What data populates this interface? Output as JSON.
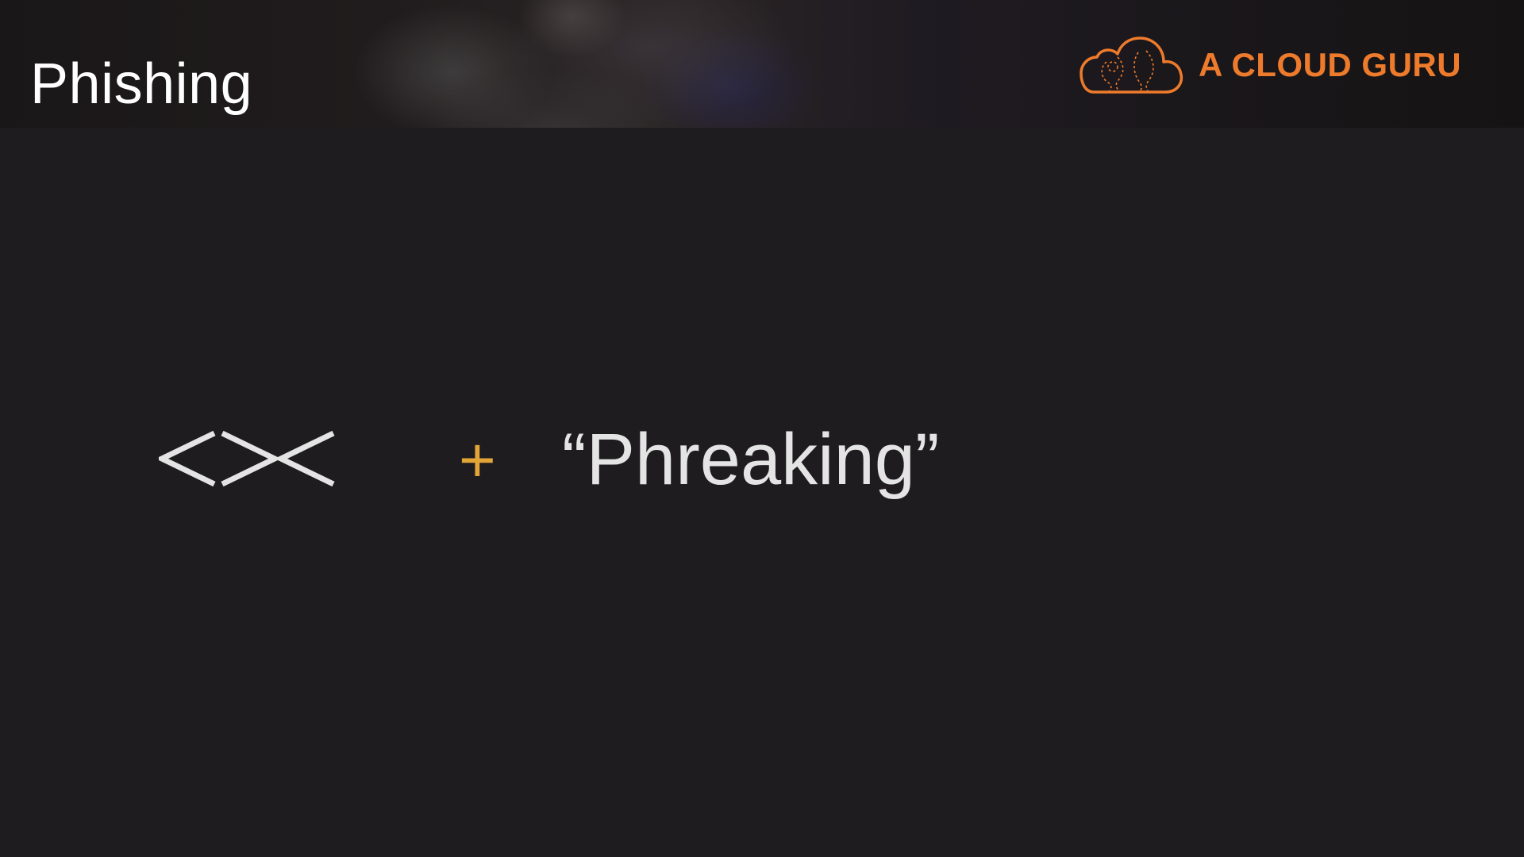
{
  "slide": {
    "title": "Phishing",
    "brand": {
      "name": "A CLOUD GURU",
      "logo_icon": "cloud-logo-icon",
      "color": "#ee7b2c"
    },
    "formula": {
      "fish_symbol_icon": "fish-symbol-icon",
      "fish_symbol_text": "<><",
      "operator": "+",
      "operator_color": "#e0a437",
      "word": "“Phreaking”"
    },
    "colors": {
      "background": "#1e1c1f",
      "text": "#e4e4e4"
    }
  }
}
